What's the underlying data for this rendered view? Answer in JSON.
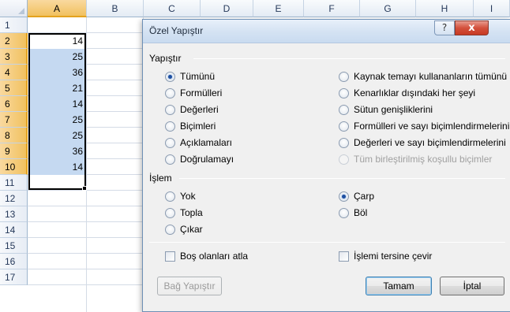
{
  "spreadsheet": {
    "columns": [
      "A",
      "B",
      "C",
      "D",
      "E",
      "F",
      "G",
      "H",
      "I"
    ],
    "selected_column": "A",
    "rows": [
      "1",
      "2",
      "3",
      "4",
      "5",
      "6",
      "7",
      "8",
      "9",
      "10",
      "11",
      "12",
      "13",
      "14",
      "15",
      "16",
      "17"
    ],
    "values": [
      "14",
      "25",
      "36",
      "21",
      "14",
      "25",
      "25",
      "36",
      "14"
    ],
    "selection_color": "#c5d9f1",
    "header_highlight_color": "#f1c15f"
  },
  "dialog": {
    "title": "Özel Yapıştır",
    "help_label": "?",
    "close_label": "x",
    "paste_section": {
      "label": "Yapıştır",
      "left_options": [
        {
          "label": "Tümünü",
          "checked": true
        },
        {
          "label": "Formülleri",
          "checked": false
        },
        {
          "label": "Değerleri",
          "checked": false
        },
        {
          "label": "Biçimleri",
          "checked": false
        },
        {
          "label": "Açıklamaları",
          "checked": false
        },
        {
          "label": "Doğrulamayı",
          "checked": false
        }
      ],
      "right_options": [
        {
          "label": "Kaynak temayı kullananların tümünü",
          "checked": false
        },
        {
          "label": "Kenarlıklar dışındaki her şeyi",
          "checked": false
        },
        {
          "label": "Sütun genişliklerini",
          "checked": false
        },
        {
          "label": "Formülleri ve sayı biçimlendirmelerini",
          "checked": false
        },
        {
          "label": "Değerleri ve sayı biçimlendirmelerini",
          "checked": false
        },
        {
          "label": "Tüm birleştirilmiş koşullu biçimler",
          "checked": false,
          "disabled": true
        }
      ]
    },
    "operation_section": {
      "label": "İşlem",
      "left_options": [
        {
          "label": "Yok",
          "checked": false
        },
        {
          "label": "Topla",
          "checked": false
        },
        {
          "label": "Çıkar",
          "checked": false
        }
      ],
      "right_options": [
        {
          "label": "Çarp",
          "checked": true
        },
        {
          "label": "Böl",
          "checked": false
        }
      ]
    },
    "skip_blanks_label": "Boş olanları atla",
    "transpose_label": "İşlemi tersine çevir",
    "paste_link_label": "Bağ Yapıştır",
    "ok_label": "Tamam",
    "cancel_label": "İptal"
  }
}
